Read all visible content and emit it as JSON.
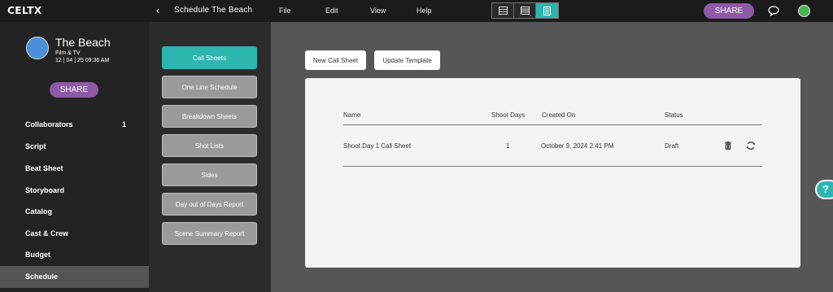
{
  "app": {
    "logo": "CELTX"
  },
  "topbar": {
    "back": "‹",
    "project_title": "Schedule The Beach",
    "menu": [
      "File",
      "Edit",
      "View",
      "Help"
    ],
    "share": "SHARE"
  },
  "project": {
    "name": "The Beach",
    "type": "Film & TV",
    "date": "12 | 04 | 25 09:36 AM"
  },
  "sidebar": {
    "share": "SHARE",
    "items": [
      {
        "label": "Collaborators",
        "count": "1"
      },
      {
        "label": "Script"
      },
      {
        "label": "Beat Sheet"
      },
      {
        "label": "Storyboard"
      },
      {
        "label": "Catalog"
      },
      {
        "label": "Cast & Crew"
      },
      {
        "label": "Budget"
      },
      {
        "label": "Schedule"
      }
    ]
  },
  "reports": [
    "Call Sheets",
    "One Line Schedule",
    "Breakdown Sheets",
    "Shot Lists",
    "Sides",
    "Day out of Days Report",
    "Scene Summary Report"
  ],
  "actions": {
    "new": "New Call Sheet",
    "update": "Update Template"
  },
  "table": {
    "headers": {
      "name": "Name",
      "days": "Shoot Days",
      "created": "Created On",
      "status": "Status"
    },
    "rows": [
      {
        "name": "Shoot Day 1 Call Sheet",
        "days": "1",
        "created": "October 9, 2024 2:41 PM",
        "status": "Draft"
      }
    ]
  },
  "help": "?",
  "colors": {
    "accent": "#2db5b0",
    "share": "#8e5aa7",
    "status": "#4caf50"
  }
}
